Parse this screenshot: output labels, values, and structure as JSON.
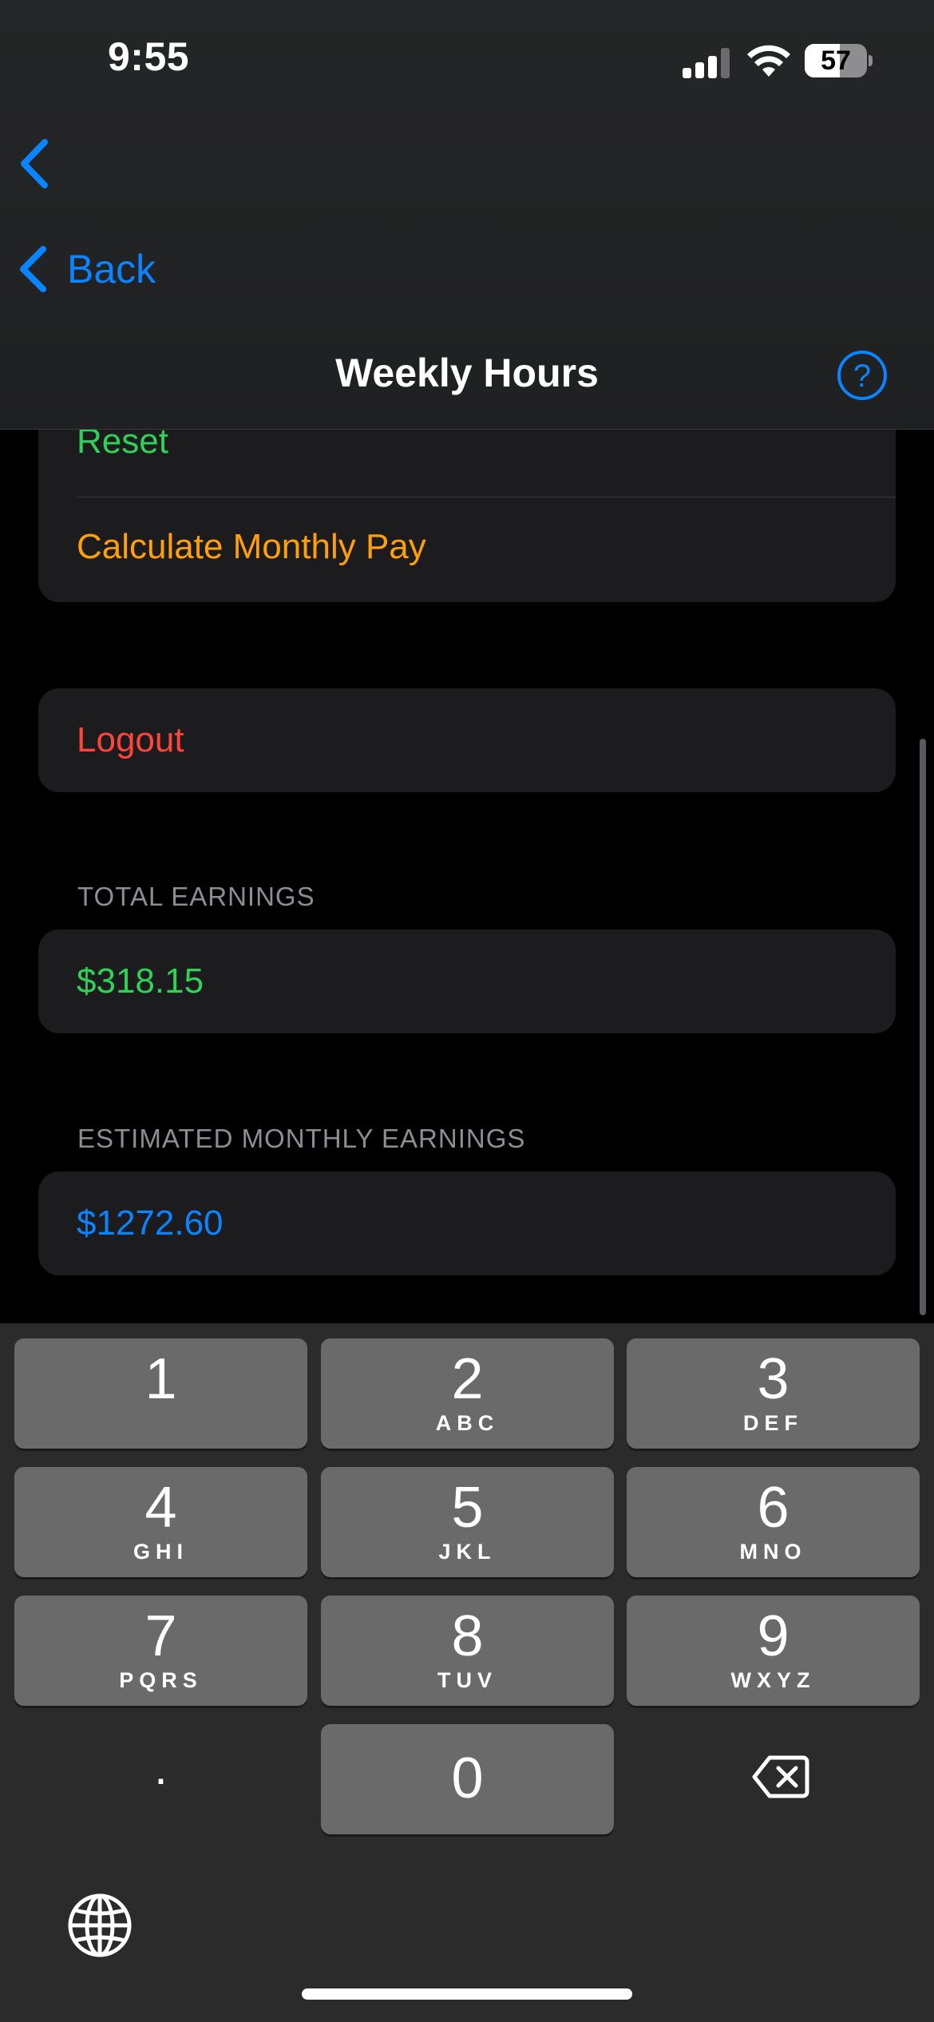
{
  "status_bar": {
    "time": "9:55",
    "battery_level": "57",
    "icons": [
      "cellular-signal-icon",
      "wifi-icon",
      "battery-icon"
    ]
  },
  "nav": {
    "back_label": "Back",
    "title": "Weekly Hours",
    "help_label": "?",
    "icons": [
      "chevron-left-icon",
      "question-circle-icon"
    ]
  },
  "actions": {
    "reset_label": "Reset",
    "calculate_label": "Calculate Monthly Pay",
    "logout_label": "Logout"
  },
  "total_earnings": {
    "header": "TOTAL EARNINGS",
    "value": "$318.15"
  },
  "estimated_earnings": {
    "header": "ESTIMATED MONTHLY EARNINGS",
    "value": "$1272.60"
  },
  "keyboard": {
    "keys": [
      {
        "digit": "1",
        "letters": ""
      },
      {
        "digit": "2",
        "letters": "ABC"
      },
      {
        "digit": "3",
        "letters": "DEF"
      },
      {
        "digit": "4",
        "letters": "GHI"
      },
      {
        "digit": "5",
        "letters": "JKL"
      },
      {
        "digit": "6",
        "letters": "MNO"
      },
      {
        "digit": "7",
        "letters": "PQRS"
      },
      {
        "digit": "8",
        "letters": "TUV"
      },
      {
        "digit": "9",
        "letters": "WXYZ"
      }
    ],
    "decimal_key": ".",
    "zero_key": "0",
    "icons": [
      "delete-backspace-icon",
      "globe-icon"
    ]
  },
  "colors": {
    "accent_blue": "#0a84ff",
    "reset_green": "#30d158",
    "calculate_orange": "#ff9f0a",
    "logout_red": "#ff453a",
    "total_green": "#30d158",
    "estimated_blue": "#0a84ff",
    "cell_background": "#1c1c1e",
    "key_background": "#6a6a6b"
  }
}
